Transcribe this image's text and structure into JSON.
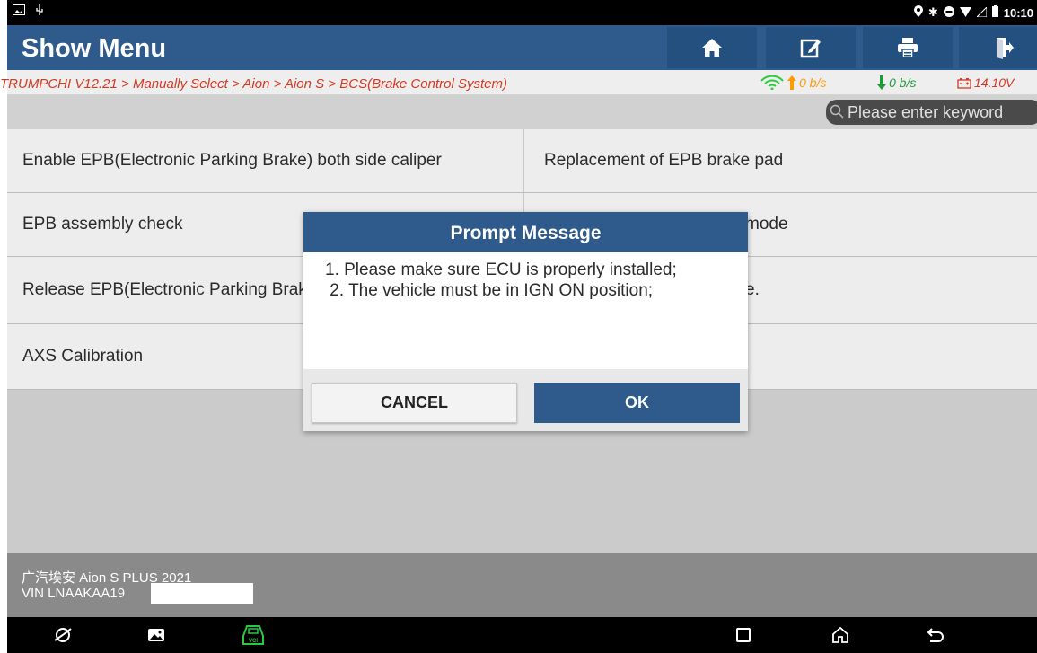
{
  "status_bar": {
    "time": "10:10"
  },
  "header": {
    "title": "Show Menu"
  },
  "breadcrumb": "TRUMPCHI V12.21 > Manually Select > Aion > Aion S > BCS(Brake Control System)",
  "network": {
    "upload": "0 b/s",
    "download": "0 b/s",
    "voltage": "14.10V"
  },
  "search": {
    "placeholder": "Please enter keyword"
  },
  "menu": {
    "left": [
      "Enable EPB(Electronic Parking Brake) both side caliper",
      "EPB assembly check",
      "Release EPB(Electronic Parking Brake) both side caliper",
      "AXS Calibration"
    ],
    "right": [
      "Replacement of EPB brake pad",
      "mode",
      "e."
    ]
  },
  "footer": {
    "vehicle": "广汽埃安 Aion S PLUS 2021",
    "vin": "VIN LNAAKAA19"
  },
  "dialog": {
    "title": "Prompt Message",
    "line1": "1. Please make sure ECU is properly installed;",
    "line2": " 2. The vehicle must be in IGN ON position;",
    "cancel": "CANCEL",
    "ok": "OK"
  },
  "colors": {
    "header": "#2e5a8c",
    "breadcrumb": "#d43a24",
    "upload": "#ff9a00",
    "download": "#1f9a3a",
    "vci": "#27c93f"
  }
}
